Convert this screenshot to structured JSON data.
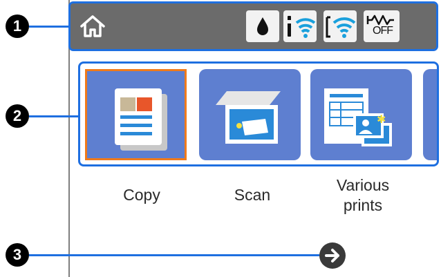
{
  "callouts": [
    "1",
    "2",
    "3"
  ],
  "status_bar": {
    "icons": [
      "home-icon",
      "ink-drop-icon",
      "wifi-direct-icon",
      "wifi-icon",
      "wired-lan-off-icon"
    ],
    "lan_status_text": "OFF"
  },
  "apps": [
    {
      "label": "Copy",
      "icon": "copy-icon",
      "selected": true
    },
    {
      "label": "Scan",
      "icon": "scan-icon",
      "selected": false
    },
    {
      "label_line1": "Various",
      "label_line2": "prints",
      "icon": "various-prints-icon",
      "selected": false
    }
  ],
  "navigation": {
    "next_icon": "arrow-right-icon"
  },
  "colors": {
    "callout_blue": "#1e6fe0",
    "tile_blue": "#5e7fd0",
    "selection_orange": "#f07a1a",
    "status_bar_gray": "#6b6b6b"
  }
}
